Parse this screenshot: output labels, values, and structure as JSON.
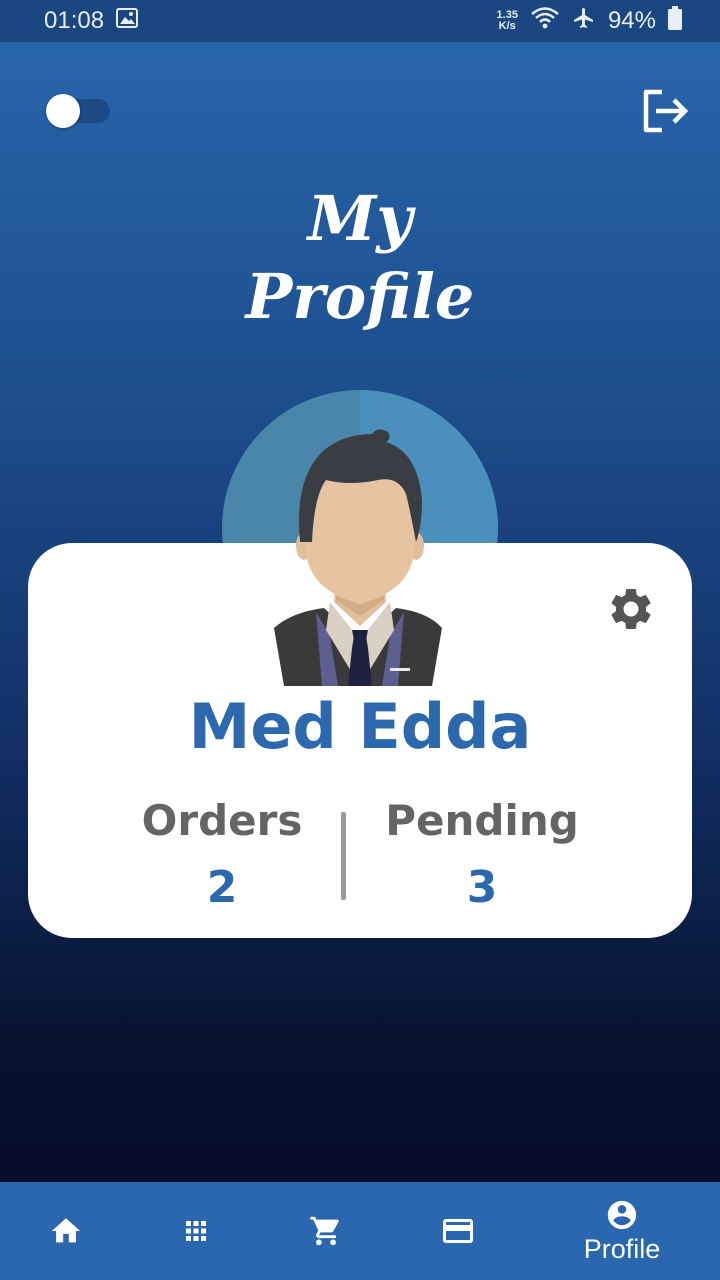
{
  "status_bar": {
    "time": "01:08",
    "net_speed_value": "1.35",
    "net_speed_unit": "K/s",
    "battery": "94%"
  },
  "header": {
    "title_line1": "My",
    "title_line2": "Profile"
  },
  "profile": {
    "name": "Med Edda",
    "stats": [
      {
        "label": "Orders",
        "value": "2"
      },
      {
        "label": "Pending",
        "value": "3"
      }
    ]
  },
  "bottom_nav": {
    "items": [
      {
        "icon": "home-icon"
      },
      {
        "icon": "grid-icon"
      },
      {
        "icon": "cart-icon"
      },
      {
        "icon": "credit-card-icon"
      },
      {
        "icon": "account-circle-icon",
        "label": "Profile"
      }
    ]
  },
  "colors": {
    "accent": "#2b68ad",
    "nav_bg": "#2a67ae",
    "stat_label": "#646464"
  }
}
